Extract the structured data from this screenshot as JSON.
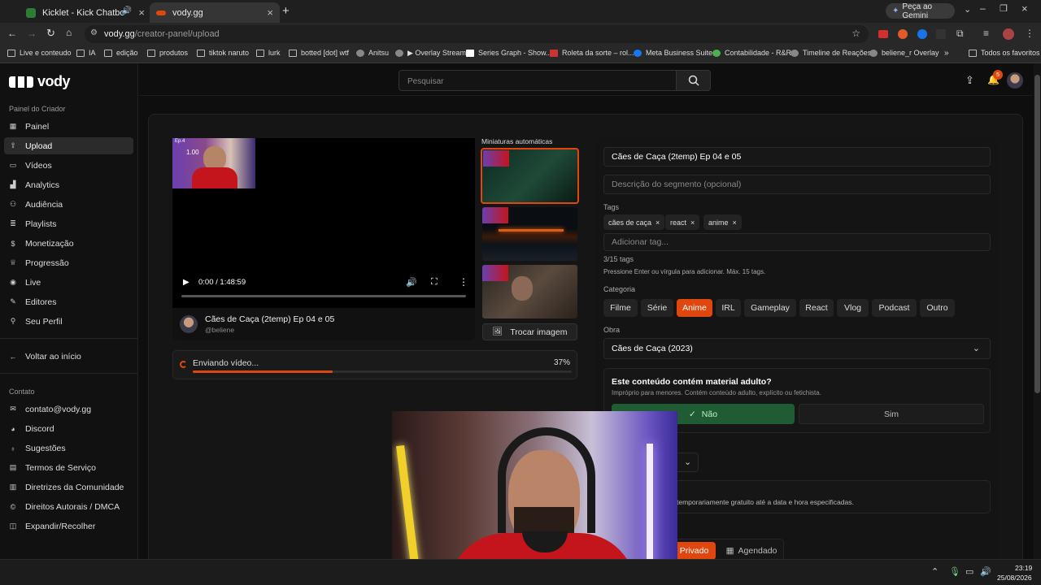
{
  "browser": {
    "tabs": [
      {
        "title": "Kicklet - Kick Chatbot, Kick"
      },
      {
        "title": "vody.gg"
      }
    ],
    "gemini": "Peça ao Gemini",
    "url_host": "vody.gg",
    "url_path": "/creator-panel/upload",
    "bookmarks": [
      "Live e conteudo",
      "IA",
      "edição",
      "produtos",
      "tiktok naruto",
      "lurk",
      "botted [dot] wtf",
      "Anitsu",
      "▶ Overlay Stream",
      "Series Graph - Show...",
      "Roleta da sorte – rol...",
      "Meta Business Suite",
      "Contabilidade - R&R",
      "Timeline de Reações",
      "beliene_r Overlay"
    ],
    "all_bookmarks": "Todos os favoritos"
  },
  "brand": "vody",
  "sidebar": {
    "section": "Painel do Criador",
    "items": [
      "Painel",
      "Upload",
      "Vídeos",
      "Analytics",
      "Audiência",
      "Playlists",
      "Monetização",
      "Progressão",
      "Live",
      "Editores",
      "Seu Perfil"
    ],
    "back": "Voltar ao início",
    "contact_section": "Contato",
    "contact_items": [
      "contato@vody.gg",
      "Discord",
      "Sugestões",
      "Termos de Serviço",
      "Diretrizes da Comunidade",
      "Direitos Autorais / DMCA",
      "Expandir/Recolher"
    ]
  },
  "header": {
    "search_placeholder": "Pesquisar",
    "notif_count": "5"
  },
  "player": {
    "time": "0:00 / 1:48:59",
    "overlay_ep": "Ep.4",
    "overlay_speed": "1.00"
  },
  "video": {
    "title": "Cães de Caça (2temp) Ep 04 e 05",
    "channel": "@beliene"
  },
  "upload": {
    "status": "Enviando vídeo...",
    "percent": "37%",
    "progress": 0.37
  },
  "thumbs": {
    "heading": "Miniaturas automáticas",
    "change": "Trocar imagem"
  },
  "form": {
    "title_value": "Cães de Caça (2temp) Ep 04 e 05",
    "desc_placeholder": "Descrição do segmento (opcional)",
    "tags_label": "Tags",
    "tags": [
      "cães de caça",
      "react",
      "anime"
    ],
    "tag_placeholder": "Adicionar tag...",
    "tag_count": "3/15 tags",
    "tag_help": "Pressione Enter ou vírgula para adicionar. Máx. 15 tags.",
    "category_label": "Categoria",
    "categories": [
      "Filme",
      "Série",
      "Anime",
      "IRL",
      "Gameplay",
      "React",
      "Vlog",
      "Podcast",
      "Outro"
    ],
    "selected_category": "Anime",
    "work_label": "Obra",
    "work_value": "Cães de Caça (2023)",
    "adult_question": "Este conteúdo contém material adulto?",
    "adult_help": "Impróprio para menores. Contém conteúdo adulto, explícito ou fetichista.",
    "adult_no": "Não",
    "adult_yes": "Sim",
    "free_help_partial": "temporariamente gratuito até a data e hora especificadas.",
    "visibility_private": "Privado",
    "visibility_scheduled": "Agendado"
  },
  "taskbar": {
    "time": "23:19",
    "date": "25/08/2026"
  },
  "colors": {
    "accent": "#e0470e",
    "success": "#1f5c34",
    "bg": "#0e0e0e"
  }
}
